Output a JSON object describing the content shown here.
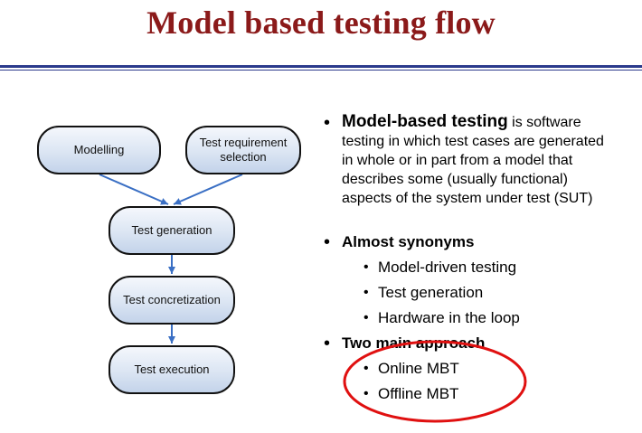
{
  "slide": {
    "title": "Model based testing flow",
    "accent_title_color": "#8b1a1a",
    "rule_color": "#2b3a8c",
    "highlight_color": "#e01010"
  },
  "diagram": {
    "nodes": {
      "modelling": "Modelling",
      "requirement_selection": "Test requirement selection",
      "generation": "Test generation",
      "concretization": "Test concretization",
      "execution": "Test execution"
    },
    "arrow_color": "#3a6fc4"
  },
  "text": {
    "bullet": "•",
    "item1_lead": "Model-based testing",
    "item1_rest": " is software testing in which test cases are generated in whole or in part from a model that describes some (usually functional) aspects of the system under test (SUT)",
    "item2_head": "Almost synonyms",
    "synonyms": [
      "Model-driven testing",
      "Test generation",
      "Hardware in the loop"
    ],
    "item3_head": "Two main approach",
    "approaches": [
      "Online MBT",
      "Offline MBT"
    ]
  }
}
